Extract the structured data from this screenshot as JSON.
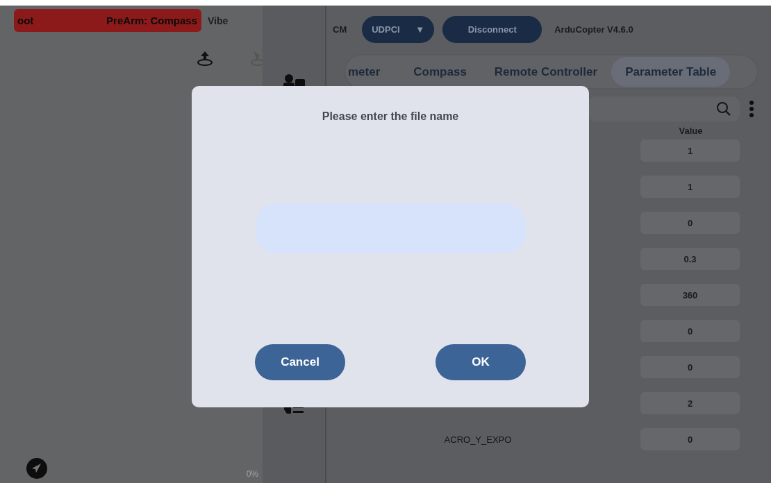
{
  "status": {
    "banner_texts": [
      "oot",
      "PreArm: Compass"
    ],
    "vibe": "Vibe",
    "progress": "0%"
  },
  "connection": {
    "label": "CM",
    "port": "UDPCI",
    "port_caret": "▼",
    "button": "Disconnect",
    "firmware": "ArduCopter V4.6.0"
  },
  "tabs": [
    {
      "label": "meter",
      "selected": false
    },
    {
      "label": "Compass",
      "selected": false
    },
    {
      "label": "Remote Controller",
      "selected": false
    },
    {
      "label": "Parameter Table",
      "selected": true
    }
  ],
  "table": {
    "columns": [
      "Value"
    ],
    "rows": [
      {
        "value": "1"
      },
      {
        "value": "1"
      },
      {
        "value": "0"
      },
      {
        "value": "0.3"
      },
      {
        "value": "360"
      },
      {
        "value": "0"
      },
      {
        "value": "0"
      },
      {
        "value": "2"
      },
      {
        "name": "ACRO_Y_EXPO",
        "value": "0"
      }
    ]
  },
  "dialog": {
    "title": "Please enter the file name",
    "buttons": [
      "Cancel",
      "OK"
    ]
  }
}
